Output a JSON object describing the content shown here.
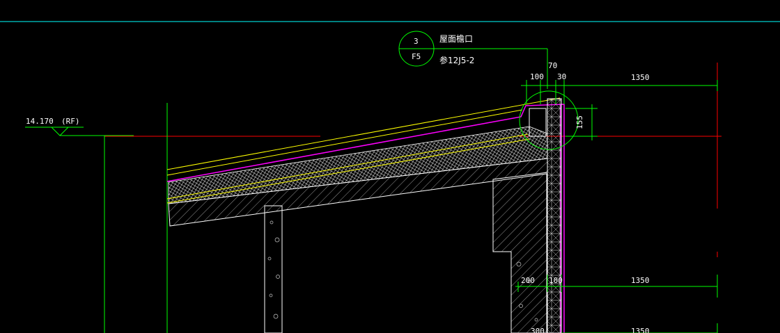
{
  "drawing": {
    "level_mark": {
      "elevation": "14.170",
      "tag": "(RF)"
    },
    "detail_callout": {
      "number": "3",
      "sheet": "F5",
      "title": "屋面檐口",
      "reference": "参12J5-2"
    },
    "dimensions": {
      "top_row": [
        "100",
        "70",
        "30",
        "1350"
      ],
      "eave_height": "155",
      "mid_row": [
        "200",
        "100",
        "1350"
      ],
      "bottom_row": [
        "300",
        "1350"
      ]
    }
  },
  "colors": {
    "background": "#000000",
    "frame_line": "#00ffff",
    "dimension": "#00ff00",
    "axis": "#ff0000",
    "roof_layer": "#ffff00",
    "waterproof": "#ff00ff",
    "structure": "#ffffff"
  }
}
